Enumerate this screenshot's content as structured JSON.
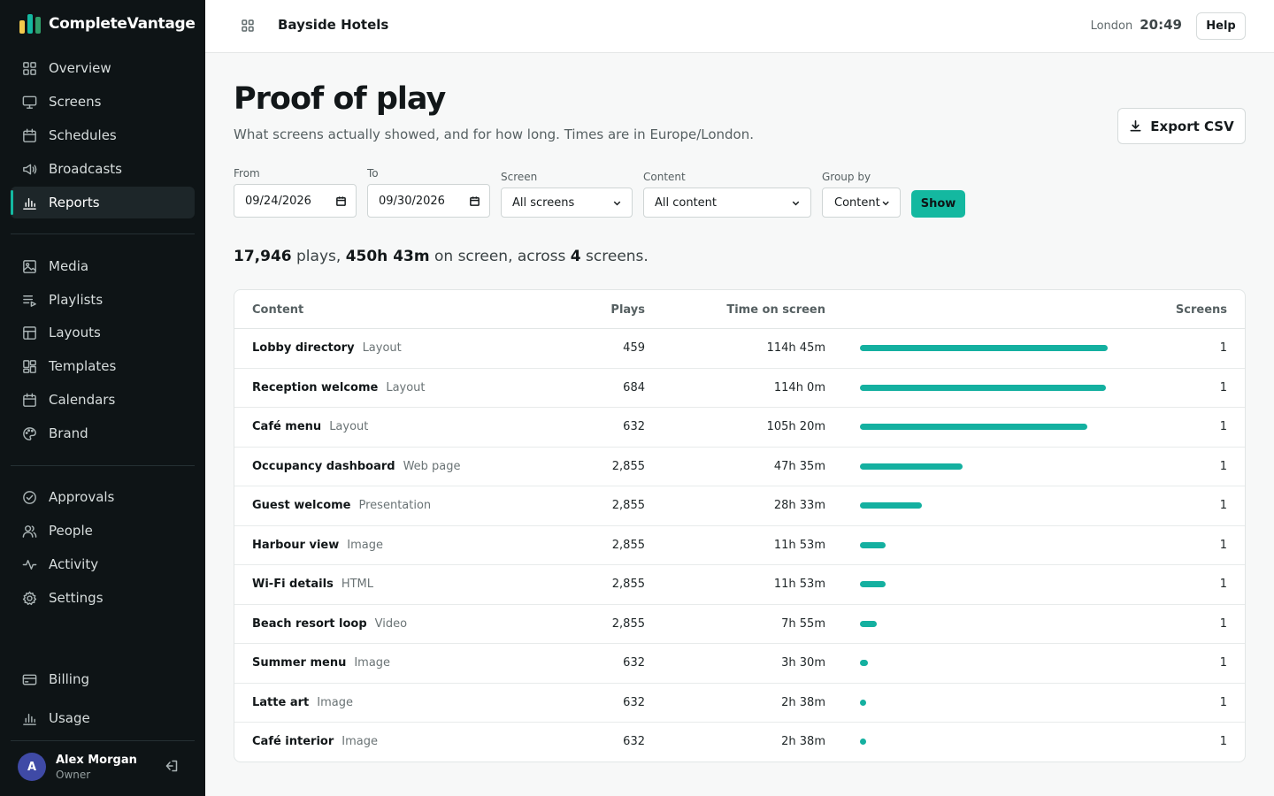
{
  "brand": {
    "name": "CompleteVantage",
    "colors": [
      "#f2c94c",
      "#14b8a0",
      "#2f9e6a"
    ]
  },
  "nav": {
    "group1": [
      {
        "label": "Overview",
        "icon": "grid-icon"
      },
      {
        "label": "Screens",
        "icon": "monitor-icon"
      },
      {
        "label": "Schedules",
        "icon": "calendar-icon"
      },
      {
        "label": "Broadcasts",
        "icon": "megaphone-icon"
      },
      {
        "label": "Reports",
        "icon": "bar-chart-icon",
        "active": true
      }
    ],
    "group2": [
      {
        "label": "Media",
        "icon": "image-icon"
      },
      {
        "label": "Playlists",
        "icon": "playlist-icon"
      },
      {
        "label": "Layouts",
        "icon": "layout-icon"
      },
      {
        "label": "Templates",
        "icon": "template-icon"
      },
      {
        "label": "Calendars",
        "icon": "calendar-icon"
      },
      {
        "label": "Brand",
        "icon": "palette-icon"
      }
    ],
    "group3": [
      {
        "label": "Approvals",
        "icon": "check-circle-icon"
      },
      {
        "label": "People",
        "icon": "people-icon"
      },
      {
        "label": "Activity",
        "icon": "activity-icon"
      },
      {
        "label": "Settings",
        "icon": "gear-icon"
      }
    ],
    "group4": [
      {
        "label": "Billing",
        "icon": "card-icon"
      },
      {
        "label": "Usage",
        "icon": "bar-chart-icon"
      }
    ]
  },
  "user": {
    "initial": "A",
    "name": "Alex Morgan",
    "role": "Owner"
  },
  "topbar": {
    "org": "Bayside Hotels",
    "city": "London",
    "time": "20:49",
    "help": "Help"
  },
  "page": {
    "title": "Proof of play",
    "subtitle": "What screens actually showed, and for how long. Times are in Europe/London.",
    "export_label": "Export CSV"
  },
  "filters": {
    "from_label": "From",
    "from_value": "09/24/2026",
    "to_label": "To",
    "to_value": "09/30/2026",
    "screen_label": "Screen",
    "screen_value": "All screens",
    "content_label": "Content",
    "content_value": "All content",
    "group_label": "Group by",
    "group_value": "Content",
    "show_label": "Show"
  },
  "summary": {
    "plays": "17,946",
    "plays_word": "plays,",
    "time": "450h 43m",
    "time_word": "on screen, across",
    "screens": "4",
    "screens_word": "screens."
  },
  "table": {
    "headers": {
      "content": "Content",
      "plays": "Plays",
      "time": "Time on screen",
      "screens": "Screens"
    },
    "accent": "#14b0a0",
    "rows": [
      {
        "name": "Lobby directory",
        "type": "Layout",
        "plays": "459",
        "time": "114h 45m",
        "share": 1.0,
        "screens": "1"
      },
      {
        "name": "Reception welcome",
        "type": "Layout",
        "plays": "684",
        "time": "114h 0m",
        "share": 0.9935,
        "screens": "1"
      },
      {
        "name": "Café menu",
        "type": "Layout",
        "plays": "632",
        "time": "105h 20m",
        "share": 0.918,
        "screens": "1"
      },
      {
        "name": "Occupancy dashboard",
        "type": "Web page",
        "plays": "2,855",
        "time": "47h 35m",
        "share": 0.4147,
        "screens": "1"
      },
      {
        "name": "Guest welcome",
        "type": "Presentation",
        "plays": "2,855",
        "time": "28h 33m",
        "share": 0.2488,
        "screens": "1"
      },
      {
        "name": "Harbour view",
        "type": "Image",
        "plays": "2,855",
        "time": "11h 53m",
        "share": 0.1036,
        "screens": "1"
      },
      {
        "name": "Wi-Fi details",
        "type": "HTML",
        "plays": "2,855",
        "time": "11h 53m",
        "share": 0.1036,
        "screens": "1"
      },
      {
        "name": "Beach resort loop",
        "type": "Video",
        "plays": "2,855",
        "time": "7h 55m",
        "share": 0.069,
        "screens": "1"
      },
      {
        "name": "Summer menu",
        "type": "Image",
        "plays": "632",
        "time": "3h 30m",
        "share": 0.0305,
        "screens": "1"
      },
      {
        "name": "Latte art",
        "type": "Image",
        "plays": "632",
        "time": "2h 38m",
        "share": 0.023,
        "screens": "1"
      },
      {
        "name": "Café interior",
        "type": "Image",
        "plays": "632",
        "time": "2h 38m",
        "share": 0.023,
        "screens": "1"
      }
    ]
  }
}
